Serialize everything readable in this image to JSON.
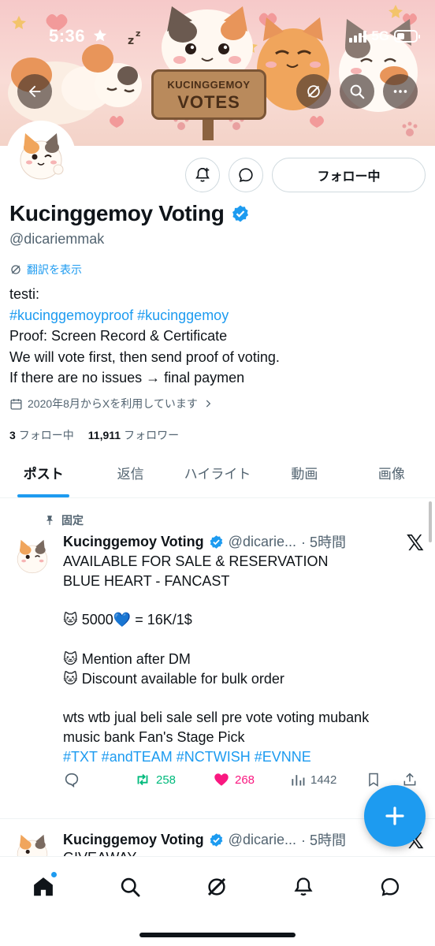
{
  "status_bar": {
    "time": "5:36",
    "network": "5G"
  },
  "banner": {
    "sign_line1": "KUCINGGEMOY",
    "sign_line2": "VOTES"
  },
  "profile": {
    "display_name": "Kucinggemoy Voting",
    "handle": "@dicariemmak",
    "follow_button": "フォロー中",
    "translate_link": "翻訳を表示",
    "bio": {
      "line1": "testi:",
      "hashtag1": "#kucinggemoyproof",
      "hashtag2": "#kucinggemoy",
      "line3": "Proof: Screen Record & Certificate",
      "line4": "We will vote first, then send proof of voting.",
      "line5": "If there are no issues → final paymen"
    },
    "joined": "2020年8月からXを利用しています",
    "following_count": "3",
    "following_label": "フォロー中",
    "followers_count": "11,911",
    "followers_label": "フォロワー"
  },
  "tabs": [
    {
      "label": "ポスト",
      "active": true
    },
    {
      "label": "返信"
    },
    {
      "label": "ハイライト"
    },
    {
      "label": "動画"
    },
    {
      "label": "画像"
    }
  ],
  "pinned_label": "固定",
  "posts": [
    {
      "name": "Kucinggemoy Voting",
      "handle": "@dicarie...",
      "time": "· 5時間",
      "lines": {
        "l1": "AVAILABLE FOR SALE & RESERVATION",
        "l2": "BLUE HEART - FANCAST",
        "l3a": "🐱 5000",
        "l3b": "💙",
        "l3c": " = 16K/1$",
        "l4": "🐱 Mention after DM",
        "l5": "🐱 Discount available for bulk order",
        "l6": "wts wtb jual beli sale sell pre vote voting mubank",
        "l7": "music bank Fan's Stage Pick",
        "l8": "#TXT #andTEAM #NCTWISH #EVNNE"
      },
      "retweets": "258",
      "likes": "268",
      "views": "1442"
    },
    {
      "name": "Kucinggemoy Voting",
      "handle": "@dicarie...",
      "time": "· 5時間",
      "preview": "GIVEAWAY"
    }
  ],
  "colors": {
    "accent": "#1d9bf0",
    "like": "#f91880",
    "retweet": "#00ba7c",
    "text": "#0f1419",
    "muted": "#536471"
  },
  "icons": [
    "back-arrow-icon",
    "retweet-cycle-icon",
    "search-icon",
    "more-icon",
    "notify-plus-icon",
    "message-icon",
    "verified-icon",
    "calendar-icon",
    "pin-icon",
    "x-logo-icon",
    "reply-icon",
    "like-icon",
    "views-icon",
    "bookmark-icon",
    "share-icon",
    "compose-plus-icon",
    "home-icon",
    "grok-icon",
    "bell-icon",
    "dm-icon"
  ]
}
